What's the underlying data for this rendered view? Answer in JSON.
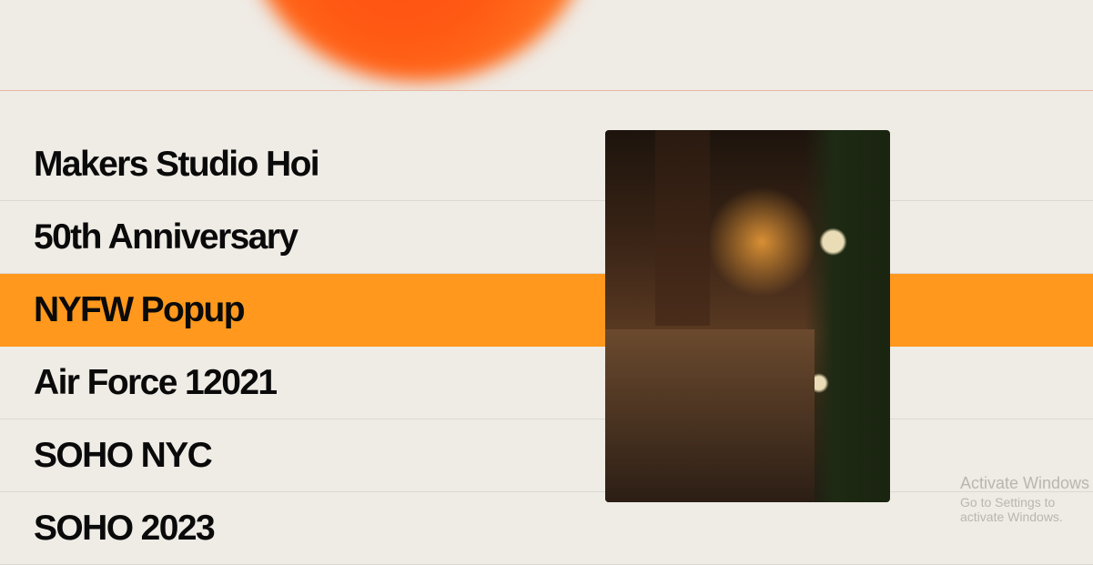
{
  "projects": [
    {
      "label": "Makers Studio Hoi"
    },
    {
      "label": "50th Anniversary"
    },
    {
      "label": "NYFW Popup",
      "active": true
    },
    {
      "label": "Air Force 12021"
    },
    {
      "label": "SOHO NYC"
    },
    {
      "label": "SOHO 2023"
    }
  ],
  "colors": {
    "accent": "#ff981c",
    "blob": "#ff5a14",
    "background": "#efebe5"
  },
  "watermark": {
    "title": "Activate Windows",
    "subtitle": "Go to Settings to activate Windows."
  }
}
